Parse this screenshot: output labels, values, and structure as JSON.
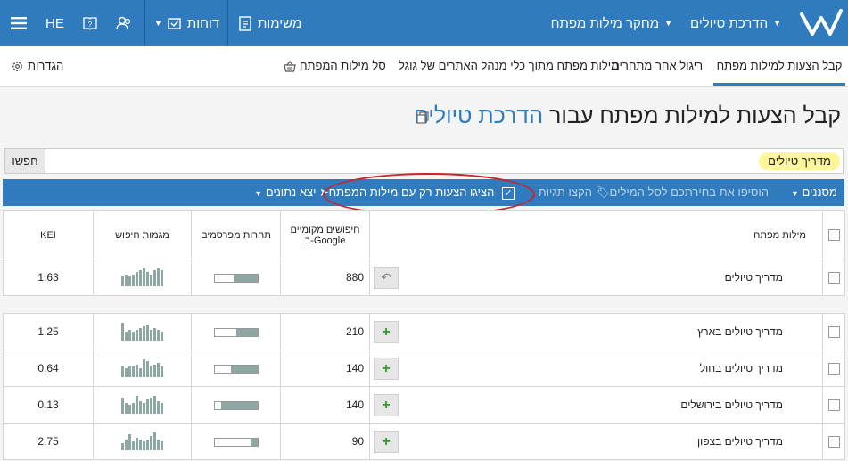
{
  "topbar": {
    "menu_project": "הדרכת טיולים",
    "menu_research": "מחקר מילות מפתח",
    "menu_tasks": "משימות",
    "menu_reports": "דוחות",
    "lang": "HE",
    "icons": [
      "logo-w",
      "clipboard-icon",
      "report-icon",
      "users-icon",
      "help-book-icon",
      "hamburger-icon"
    ]
  },
  "tabs": {
    "t1": "קבל הצעות למילות מפתח",
    "t2": "ריגול אחר מתחרים",
    "t3": "מילות מפתח מתוך כלי מנהל האתרים של גוגל",
    "t4": "סל מילות המפתח",
    "settings": "הגדרות"
  },
  "heading": {
    "prefix": "קבל הצעות למילות מפתח עבור",
    "project": "הדרכת טיולים"
  },
  "search": {
    "button": "חפשו",
    "chip": "מדריך טיולים"
  },
  "toolbar": {
    "filters": "מסננים",
    "add_basket": "הוסיפו את בחירתכם לסל המילים",
    "tags": "הקצו תגיות",
    "only_with_keyword": "הציגו הצעות רק עם מילות המפתח",
    "export": "יצא נתונים"
  },
  "table": {
    "col_kw": "מילות מפתח",
    "col_searches_l1": "חיפושים מקומיים",
    "col_searches_l2": "ב-Google",
    "col_competition": "תחרות מפרסמים",
    "col_trend": "מגמות חיפוש",
    "col_kei": "KEI",
    "main_row": {
      "keyword": "מדריך טיולים",
      "searches": "880",
      "kei": "1.63",
      "competition": 0.55,
      "trend": [
        5,
        6,
        5,
        6,
        7,
        8,
        9,
        7,
        6,
        8,
        9,
        8
      ]
    },
    "rows": [
      {
        "keyword": "מדריך טיולים בארץ",
        "searches": "210",
        "kei": "1.25",
        "competition": 0.5,
        "trend": [
          10,
          5,
          6,
          5,
          6,
          7,
          8,
          9,
          6,
          7,
          6,
          5
        ]
      },
      {
        "keyword": "מדריך טיולים בחול",
        "searches": "140",
        "kei": "0.64",
        "competition": 0.62,
        "trend": [
          6,
          5,
          6,
          6,
          7,
          5,
          10,
          9,
          6,
          7,
          8,
          6
        ]
      },
      {
        "keyword": "מדריך טיולים בירושלים",
        "searches": "140",
        "kei": "0.13",
        "competition": 0.85,
        "trend": [
          9,
          6,
          5,
          6,
          10,
          7,
          6,
          8,
          9,
          10,
          7,
          6
        ]
      },
      {
        "keyword": "מדריך טיולים בצפון",
        "searches": "90",
        "kei": "2.75",
        "competition": 0.15,
        "trend": [
          4,
          6,
          9,
          5,
          7,
          6,
          5,
          6,
          8,
          10,
          6,
          5
        ]
      }
    ]
  }
}
